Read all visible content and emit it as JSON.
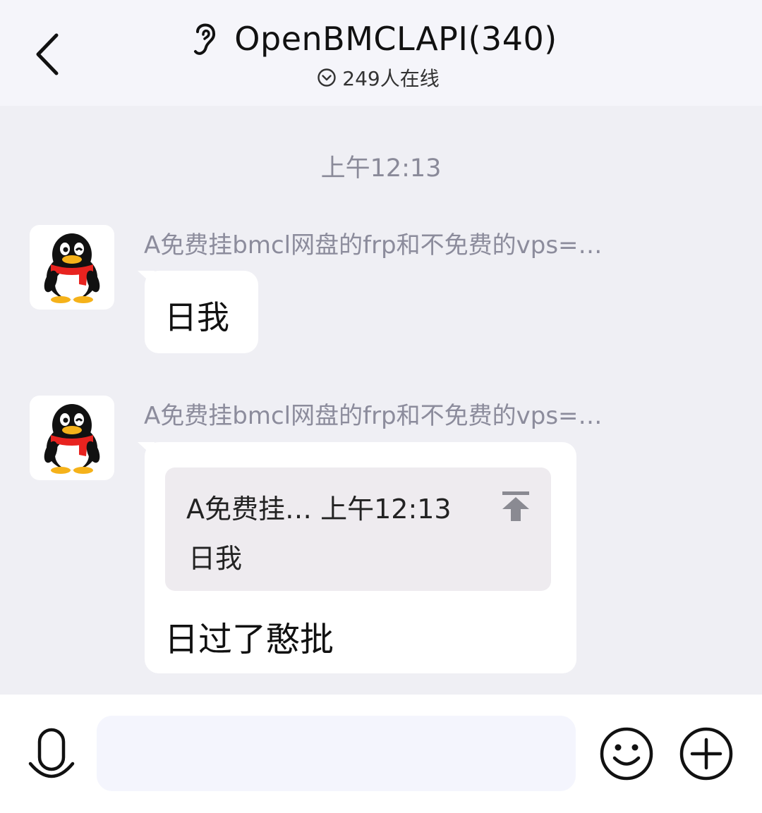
{
  "header": {
    "back_icon": "chevron-left-icon",
    "title_icon": "ear-icon",
    "title": "OpenBMCLAPI(340)",
    "online_icon": "chevron-down-circle-icon",
    "online_count": "249人在线"
  },
  "chat": {
    "timestamp": "上午12:13",
    "messages": [
      {
        "avatar_icon": "qq-penguin-icon",
        "sender": "A免费挂bmcl网盘的frp和不免费的vps=…",
        "text": "日我"
      },
      {
        "avatar_icon": "qq-penguin-icon",
        "sender": "A免费挂bmcl网盘的frp和不免费的vps=…",
        "quote": {
          "sender": "A免费挂…",
          "time": "上午12:13",
          "text": "日我",
          "icon": "jump-to-top-icon"
        },
        "text": "日过了憨批"
      }
    ]
  },
  "input_bar": {
    "voice_icon": "microphone-icon",
    "placeholder": "",
    "value": "",
    "emoji_icon": "smiley-icon",
    "plus_icon": "plus-circle-icon"
  },
  "colors": {
    "header_bg": "#f5f5fa",
    "chat_bg": "#efeff4",
    "bubble_bg": "#ffffff",
    "quote_bg": "#eeebef",
    "meta_text": "#8c8c9c",
    "input_bg": "#f4f5fd",
    "penguin_scarf": "#e8231f",
    "penguin_beak": "#f5b21a"
  }
}
